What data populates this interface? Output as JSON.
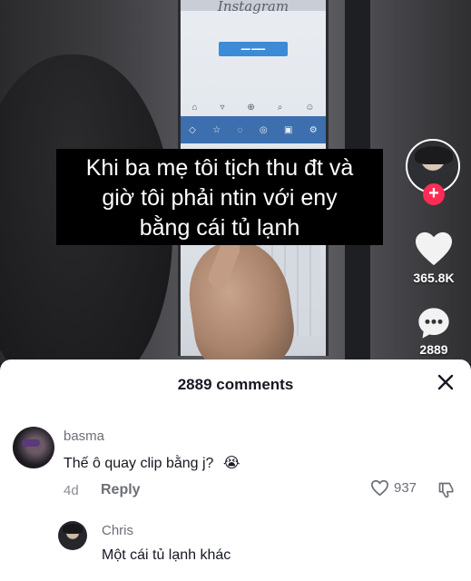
{
  "video": {
    "screen_logo": "Instagram",
    "caption_lines": [
      "Khi ba mẹ tôi tịch thu đt và",
      "giờ tôi phải ntin với eny",
      "bằng cái tủ lạnh"
    ],
    "likes_count": "365.8K",
    "comments_count": "2889"
  },
  "sheet": {
    "title": "2889 comments",
    "comments": [
      {
        "username": "basma",
        "text": "Thế ô quay clip bằng j?",
        "emoji": "😭",
        "age": "4d",
        "reply_label": "Reply",
        "likes": "937"
      },
      {
        "username": "Chris",
        "text": "Một cái tủ lạnh khác"
      }
    ]
  },
  "icons": {
    "follow": "plus-icon",
    "like": "heart-icon",
    "comment": "chat-bubble-icon",
    "close": "close-icon",
    "comment_like": "heart-outline-icon",
    "dislike": "thumbs-down-icon"
  },
  "colors": {
    "follow_accent": "#fe2c55",
    "sheet_bg": "#ffffff",
    "caption_bg": "#000000"
  }
}
